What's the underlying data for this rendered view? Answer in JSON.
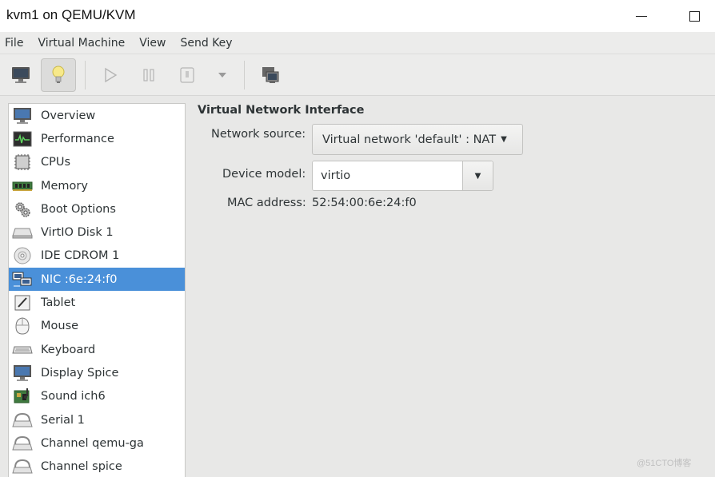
{
  "window": {
    "title": "kvm1 on QEMU/KVM"
  },
  "menubar": {
    "items": [
      "File",
      "Virtual Machine",
      "View",
      "Send Key"
    ]
  },
  "toolbar": {
    "icons": [
      "console-icon",
      "lightbulb-details-icon",
      "run-icon",
      "pause-icon",
      "shutdown-icon",
      "shutdown-menu-icon",
      "snapshots-icon"
    ]
  },
  "sidebar": {
    "items": [
      {
        "label": "Overview",
        "icon": "monitor-icon"
      },
      {
        "label": "Performance",
        "icon": "performance-graph-icon"
      },
      {
        "label": "CPUs",
        "icon": "cpu-chip-icon"
      },
      {
        "label": "Memory",
        "icon": "memory-module-icon"
      },
      {
        "label": "Boot Options",
        "icon": "gears-icon"
      },
      {
        "label": "VirtIO Disk 1",
        "icon": "hard-disk-icon"
      },
      {
        "label": "IDE CDROM 1",
        "icon": "cdrom-icon"
      },
      {
        "label": "NIC :6e:24:f0",
        "icon": "network-card-icon",
        "selected": true
      },
      {
        "label": "Tablet",
        "icon": "tablet-icon"
      },
      {
        "label": "Mouse",
        "icon": "mouse-icon"
      },
      {
        "label": "Keyboard",
        "icon": "keyboard-icon"
      },
      {
        "label": "Display Spice",
        "icon": "display-icon"
      },
      {
        "label": "Sound ich6",
        "icon": "sound-card-icon"
      },
      {
        "label": "Serial 1",
        "icon": "serial-port-icon"
      },
      {
        "label": "Channel qemu-ga",
        "icon": "channel-icon"
      },
      {
        "label": "Channel spice",
        "icon": "channel-icon"
      }
    ],
    "selected_color": "#4a90d9"
  },
  "details": {
    "section_title": "Virtual Network Interface",
    "network_source_label": "Network source:",
    "network_source_value": "Virtual network 'default' : NAT",
    "device_model_label": "Device model:",
    "device_model_value": "virtio",
    "mac_label": "MAC address:",
    "mac_value": "52:54:00:6e:24:f0"
  },
  "watermark": "@51CTO博客"
}
